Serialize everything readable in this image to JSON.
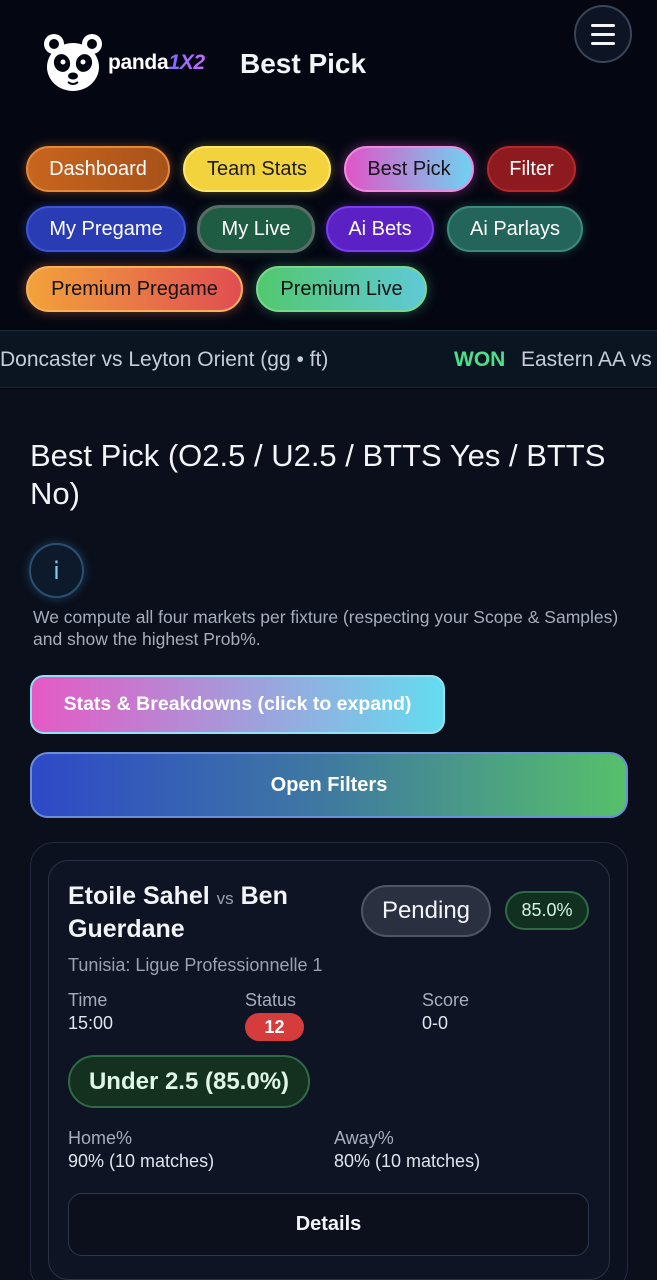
{
  "header": {
    "brand_part1": "panda",
    "brand_part2": "1X2",
    "page_title": "Best Pick",
    "menu_icon": "hamburger-menu-icon"
  },
  "nav": {
    "dashboard": "Dashboard",
    "team_stats": "Team Stats",
    "best_pick": "Best Pick",
    "filter": "Filter",
    "my_pregame": "My Pregame",
    "my_live": "My Live",
    "ai_bets": "Ai Bets",
    "ai_parlays": "Ai Parlays",
    "premium_pregame": "Premium Pregame",
    "premium_live": "Premium Live"
  },
  "ticker": {
    "item1": "Doncaster vs Leyton Orient (gg • ft)",
    "result1": "WON",
    "item2": "Eastern AA vs"
  },
  "main": {
    "title": "Best Pick (O2.5 / U2.5 / BTTS Yes / BTTS No)",
    "info_glyph": "i",
    "description": "We compute all four markets per fixture (respecting your Scope & Samples) and show the highest Prob%.",
    "stats_button": "Stats & Breakdowns (click to expand)",
    "filters_button": "Open Filters"
  },
  "fixture": {
    "home_team": "Etoile Sahel",
    "vs": "vs",
    "away_team": "Ben Guerdane",
    "status_badge": "Pending",
    "probability": "85.0%",
    "league": "Tunisia: Ligue Professionnelle 1",
    "time_label": "Time",
    "time_value": "15:00",
    "status_label": "Status",
    "status_value": "12",
    "score_label": "Score",
    "score_value": "0-0",
    "pick": "Under 2.5 (85.0%)",
    "home_pct_label": "Home%",
    "home_pct_value": "90% (10 matches)",
    "away_pct_label": "Away%",
    "away_pct_value": "80% (10 matches)",
    "details_button": "Details"
  },
  "colors": {
    "background": "#040712",
    "won": "#4be08a",
    "status_live": "#d63c3c"
  }
}
